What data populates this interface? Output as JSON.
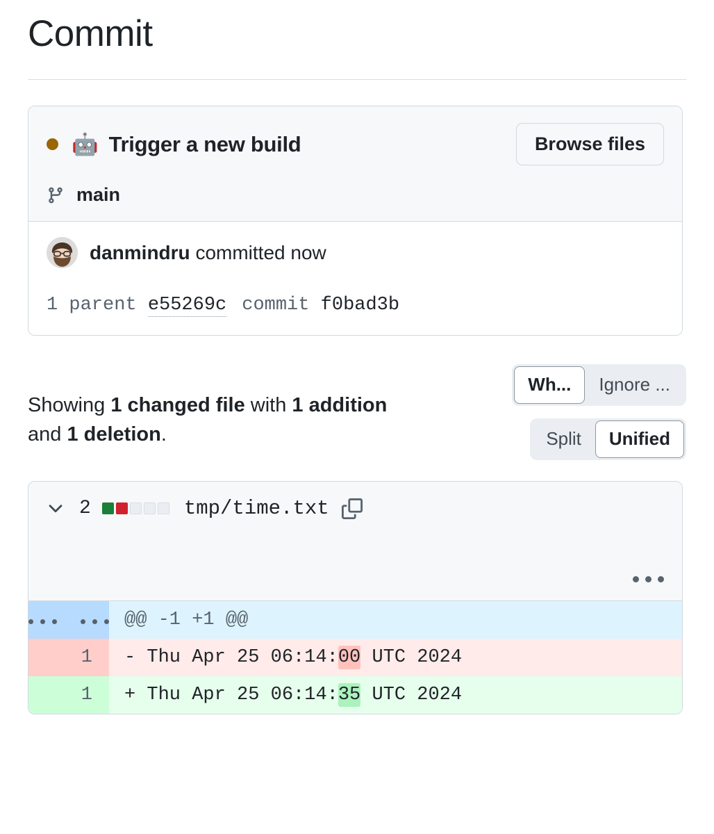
{
  "page": {
    "title": "Commit"
  },
  "commit": {
    "status_dot_color": "#9a6700",
    "emoji": "🤖",
    "message": "Trigger a new build",
    "browse_files_label": "Browse files",
    "branch_icon": "git-branch-icon",
    "branch": "main",
    "author": "danmindru",
    "author_action": " committed now",
    "parent_label": "1 parent",
    "parent_sha": "e55269c",
    "commit_label": "commit",
    "commit_sha": "f0bad3b"
  },
  "summary": {
    "prefix": "Showing ",
    "changed_files": "1 changed file",
    "middle": " with ",
    "additions": "1 addition",
    "conjunction": " and ",
    "deletions": "1 deletion",
    "suffix": "."
  },
  "toggles": {
    "whitespace": {
      "selected_label": "Wh...",
      "other_label": "Ignore ..."
    },
    "view": {
      "split_label": "Split",
      "unified_label": "Unified"
    }
  },
  "file": {
    "chevron_icon": "chevron-down-icon",
    "change_count": "2",
    "diffstat": [
      "add",
      "del",
      "neutral",
      "neutral",
      "neutral"
    ],
    "path": "tmp/time.txt",
    "copy_icon": "copy-icon",
    "menu_icon": "kebab-menu-icon"
  },
  "diff": {
    "hunk_header": "@@ -1 +1 @@",
    "deletion": {
      "line_number": "1",
      "prefix": "- Thu Apr 25 06:14:",
      "highlight": "00",
      "suffix": " UTC 2024"
    },
    "addition": {
      "line_number": "1",
      "prefix": "+ Thu Apr 25 06:14:",
      "highlight": "35",
      "suffix": " UTC 2024"
    }
  },
  "colors": {
    "addition_green": "#1a7f37",
    "deletion_red": "#cf222e",
    "hunk_blue": "#ddf4ff",
    "status_dot": "#9a6700"
  }
}
